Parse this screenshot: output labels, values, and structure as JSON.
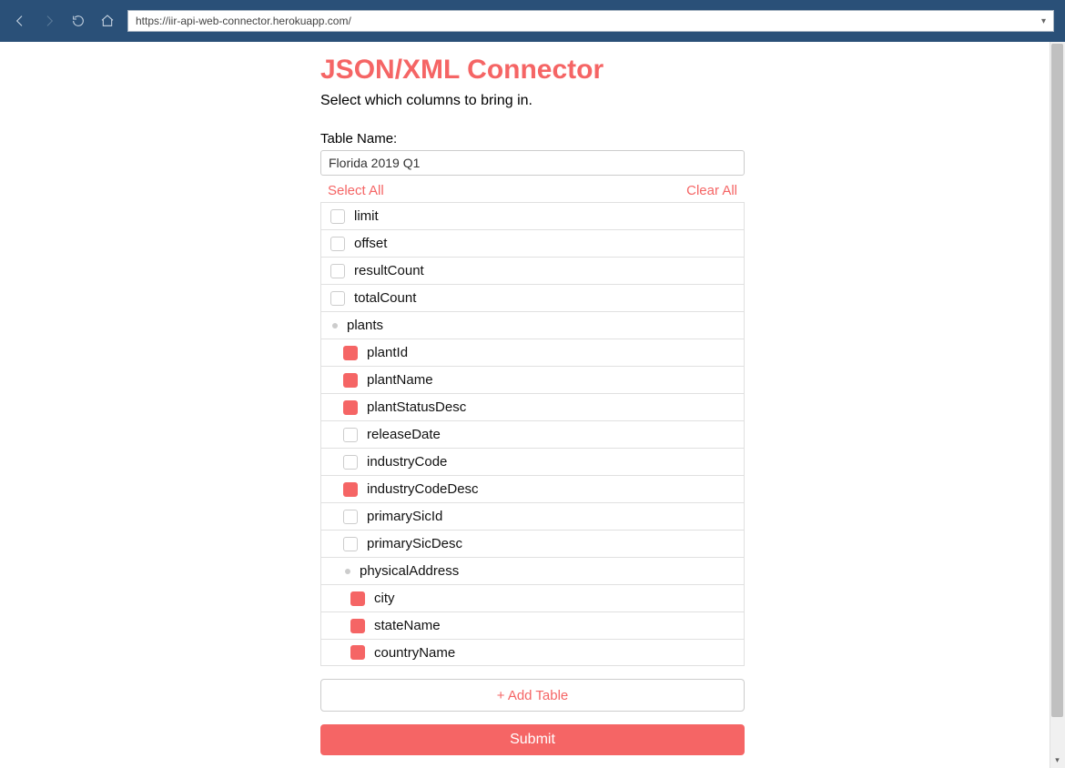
{
  "browser": {
    "url": "https://iir-api-web-connector.herokuapp.com/"
  },
  "page": {
    "title": "JSON/XML Connector",
    "subtitle": "Select which columns to bring in.",
    "table_name_label": "Table Name:",
    "table_name_value": "Florida 2019 Q1",
    "select_all": "Select All",
    "clear_all": "Clear All",
    "add_table": "+ Add Table",
    "submit": "Submit"
  },
  "tree": [
    {
      "label": "limit",
      "type": "checkbox",
      "checked": false,
      "indent": 0
    },
    {
      "label": "offset",
      "type": "checkbox",
      "checked": false,
      "indent": 0
    },
    {
      "label": "resultCount",
      "type": "checkbox",
      "checked": false,
      "indent": 0
    },
    {
      "label": "totalCount",
      "type": "checkbox",
      "checked": false,
      "indent": 0
    },
    {
      "label": "plants",
      "type": "group",
      "indent": 0
    },
    {
      "label": "plantId",
      "type": "checkbox",
      "checked": true,
      "indent": 1
    },
    {
      "label": "plantName",
      "type": "checkbox",
      "checked": true,
      "indent": 1
    },
    {
      "label": "plantStatusDesc",
      "type": "checkbox",
      "checked": true,
      "indent": 1
    },
    {
      "label": "releaseDate",
      "type": "checkbox",
      "checked": false,
      "indent": 1
    },
    {
      "label": "industryCode",
      "type": "checkbox",
      "checked": false,
      "indent": 1
    },
    {
      "label": "industryCodeDesc",
      "type": "checkbox",
      "checked": true,
      "indent": 1
    },
    {
      "label": "primarySicId",
      "type": "checkbox",
      "checked": false,
      "indent": 1
    },
    {
      "label": "primarySicDesc",
      "type": "checkbox",
      "checked": false,
      "indent": 1
    },
    {
      "label": "physicalAddress",
      "type": "group",
      "indent": 1
    },
    {
      "label": "city",
      "type": "checkbox",
      "checked": true,
      "indent": 2
    },
    {
      "label": "stateName",
      "type": "checkbox",
      "checked": true,
      "indent": 2
    },
    {
      "label": "countryName",
      "type": "checkbox",
      "checked": true,
      "indent": 2
    }
  ]
}
